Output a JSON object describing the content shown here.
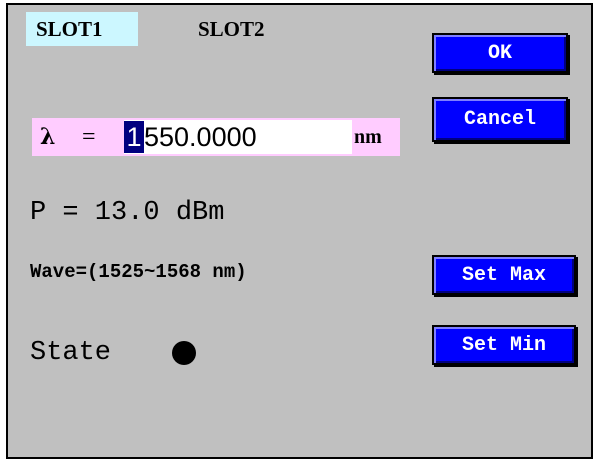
{
  "tabs": [
    {
      "label": "SLOT1",
      "active": true
    },
    {
      "label": "SLOT2",
      "active": false
    }
  ],
  "buttons": {
    "ok": "OK",
    "cancel": "Cancel",
    "set_max": "Set Max",
    "set_min": "Set Min"
  },
  "wavelength": {
    "symbol": "λ",
    "equals": "=",
    "cursor_digit": "1",
    "value_rest": "550.0000",
    "unit": "nm"
  },
  "power": {
    "text": "P = 13.0 dBm"
  },
  "wave_range": {
    "text": "Wave=(1525~1568 nm)"
  },
  "state": {
    "label": "State"
  },
  "colors": {
    "window_bg": "#c0c0c0",
    "button_bg": "#0000ff",
    "active_tab_bg": "#ccf7ff",
    "input_row_bg": "#ffccff",
    "cursor_bg": "#000080"
  }
}
